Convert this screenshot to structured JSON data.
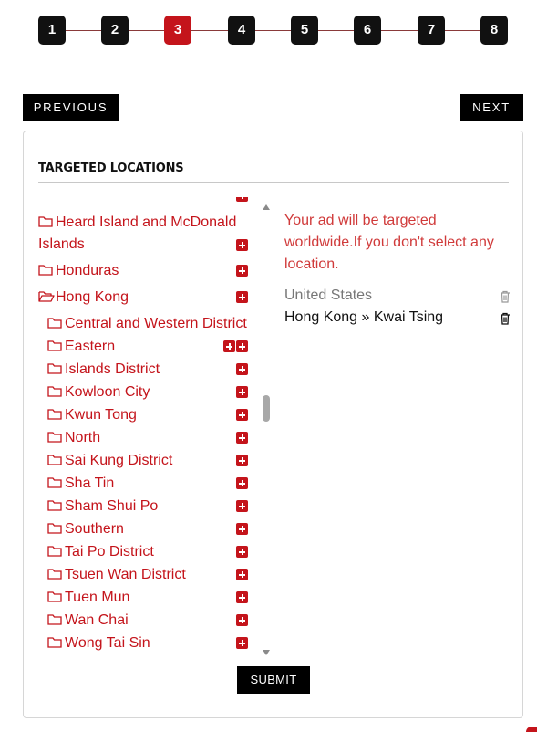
{
  "stepper": {
    "steps": [
      "1",
      "2",
      "3",
      "4",
      "5",
      "6",
      "7",
      "8"
    ],
    "active_step": "3"
  },
  "nav": {
    "previous_label": "PREVIOUS",
    "next_label": "NEXT"
  },
  "card": {
    "title": "TARGETED LOCATIONS"
  },
  "tree": {
    "countries": [
      {
        "label": "Heard Island and McDonald Islands"
      },
      {
        "label": "Honduras"
      },
      {
        "label": "Hong Kong",
        "expanded": true
      }
    ],
    "districts": [
      "Central and Western District",
      "Eastern",
      "Islands District",
      "Kowloon City",
      "Kwun Tong",
      "North",
      "Sai Kung District",
      "Sha Tin",
      "Sham Shui Po",
      "Southern",
      "Tai Po District",
      "Tsuen Wan District",
      "Tuen Mun",
      "Wan Chai",
      "Wong Tai Sin"
    ]
  },
  "selection": {
    "notice": "Your ad will be targeted worldwide.If you don't select any location.",
    "items": [
      {
        "label": "United States",
        "muted": true
      },
      {
        "label": "Hong Kong » Kwai Tsing",
        "muted": false
      }
    ]
  },
  "submit_label": "SUBMIT",
  "colors": {
    "accent": "#c4141b",
    "dark": "#000000"
  },
  "icons": [
    "folder-icon",
    "folder-open-icon",
    "plus-icon",
    "trash-icon"
  ]
}
